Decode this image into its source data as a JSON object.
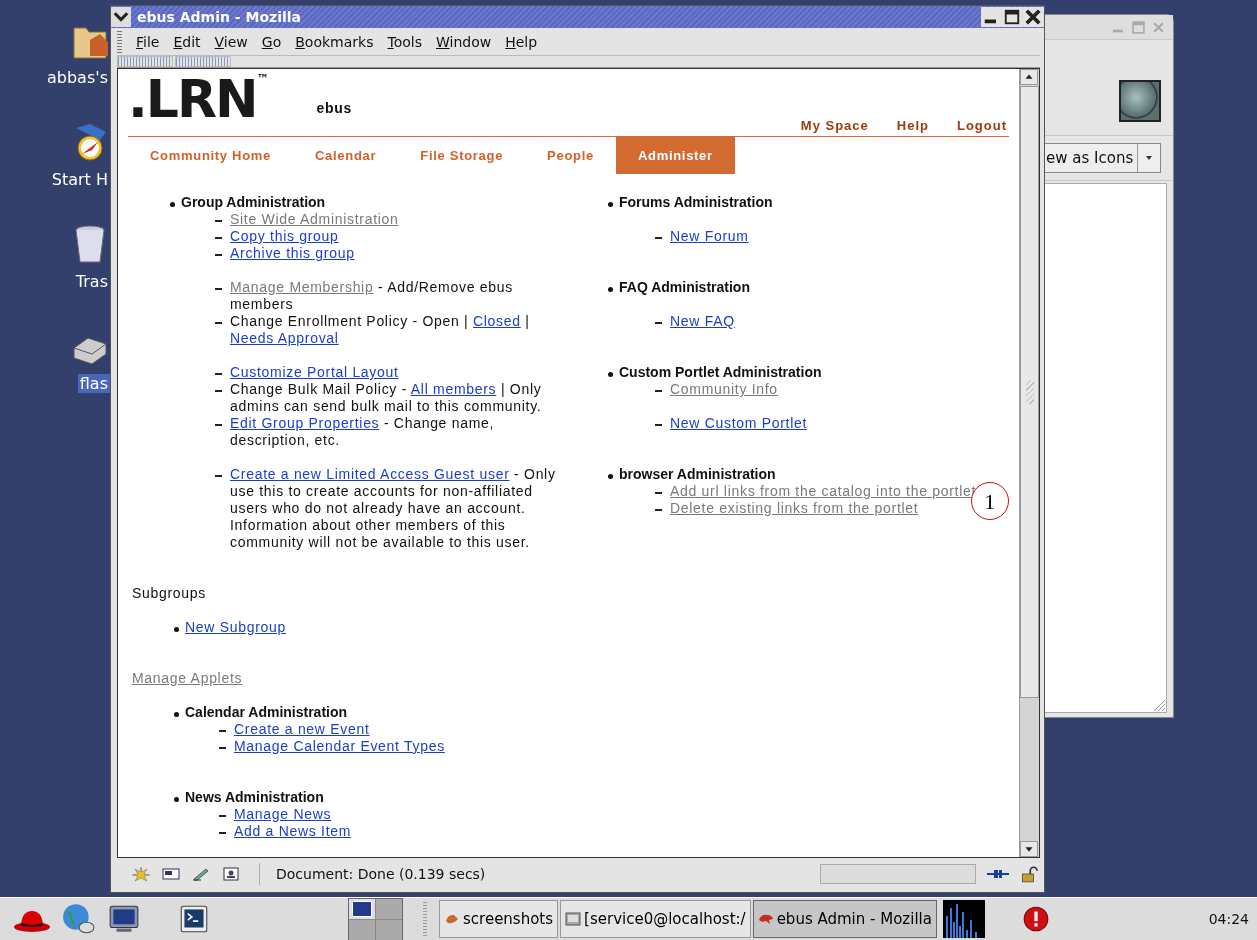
{
  "desktop_icons": [
    {
      "label": "abbas's",
      "kind": "folder",
      "selected": false
    },
    {
      "label": "Start H",
      "kind": "compass",
      "selected": false
    },
    {
      "label": "Tras",
      "kind": "trash",
      "selected": false
    },
    {
      "label": "flas",
      "kind": "drive",
      "selected": true
    }
  ],
  "back_window": {
    "view_mode": "ew as Icons"
  },
  "window": {
    "title": "ebus Admin - Mozilla",
    "menu": [
      "File",
      "Edit",
      "View",
      "Go",
      "Bookmarks",
      "Tools",
      "Window",
      "Help"
    ]
  },
  "page": {
    "logo": ".LRN",
    "trademark": "™",
    "community": "ebus",
    "top_links": [
      "My Space",
      "Help",
      "Logout"
    ],
    "tabs": [
      {
        "label": "Community Home",
        "selected": false
      },
      {
        "label": "Calendar",
        "selected": false
      },
      {
        "label": "File Storage",
        "selected": false
      },
      {
        "label": "People",
        "selected": false
      },
      {
        "label": "Administer",
        "selected": true
      }
    ],
    "left_sections": [
      {
        "title": "Group Administration",
        "kind": "tight",
        "groups": [
          [
            {
              "parts": [
                {
                  "kind": "link",
                  "text": "Site Wide Administration",
                  "visited": true
                }
              ]
            },
            {
              "parts": [
                {
                  "kind": "link",
                  "text": "Copy this group",
                  "visited": false
                }
              ]
            },
            {
              "parts": [
                {
                  "kind": "link",
                  "text": "Archive this group",
                  "visited": false
                }
              ]
            }
          ],
          [
            {
              "parts": [
                {
                  "kind": "link",
                  "text": "Manage Membership",
                  "visited": true
                },
                {
                  "kind": "text",
                  "text": " - Add/Remove ebus members"
                }
              ]
            },
            {
              "parts": [
                {
                  "kind": "text",
                  "text": "Change Enrollment Policy - Open | "
                },
                {
                  "kind": "link",
                  "text": "Closed",
                  "visited": false
                },
                {
                  "kind": "text",
                  "text": " | "
                },
                {
                  "kind": "link",
                  "text": "Needs Approval",
                  "visited": false
                }
              ]
            }
          ],
          [
            {
              "parts": [
                {
                  "kind": "link",
                  "text": "Customize Portal Layout",
                  "visited": false
                }
              ]
            },
            {
              "parts": [
                {
                  "kind": "text",
                  "text": "Change Bulk Mail Policy - "
                },
                {
                  "kind": "link",
                  "text": "All members",
                  "visited": false
                },
                {
                  "kind": "text",
                  "text": " | Only admins can send bulk mail to this community."
                }
              ]
            },
            {
              "parts": [
                {
                  "kind": "link",
                  "text": "Edit Group Properties",
                  "visited": false
                },
                {
                  "kind": "text",
                  "text": " - Change name, description, etc."
                }
              ]
            }
          ],
          [
            {
              "parts": [
                {
                  "kind": "link",
                  "text": "Create a new Limited Access Guest user",
                  "visited": false
                },
                {
                  "kind": "text",
                  "text": " - Only use this to create accounts for non-affiliated users who do not already have an account. Information about other members of this community will not be available to this user."
                }
              ]
            }
          ]
        ]
      }
    ],
    "right_sections": [
      {
        "title": "Forums Administration",
        "kind": "loose",
        "groups": [
          [
            {
              "parts": [
                {
                  "kind": "link",
                  "text": "New Forum",
                  "visited": false
                }
              ]
            }
          ]
        ]
      },
      {
        "title": "FAQ Administration",
        "kind": "loose",
        "groups": [
          [
            {
              "parts": [
                {
                  "kind": "link",
                  "text": "New FAQ",
                  "visited": false
                }
              ]
            }
          ]
        ]
      },
      {
        "title": "Custom Portlet Administration",
        "kind": "tight",
        "groups": [
          [
            {
              "parts": [
                {
                  "kind": "link",
                  "text": "Community Info",
                  "visited": true
                }
              ]
            }
          ],
          [
            {
              "parts": [
                {
                  "kind": "link",
                  "text": "New Custom Portlet",
                  "visited": false
                }
              ]
            }
          ]
        ]
      },
      {
        "title": "browser Administration",
        "kind": "tight",
        "groups": [
          [
            {
              "parts": [
                {
                  "kind": "link",
                  "text": "Add url links from the catalog into the portlet",
                  "visited": true
                }
              ]
            },
            {
              "parts": [
                {
                  "kind": "link",
                  "text": "Delete existing links from the portlet",
                  "visited": true
                }
              ]
            }
          ]
        ]
      }
    ],
    "subgroups": {
      "heading": "Subgroups",
      "links": [
        {
          "text": "New Subgroup",
          "visited": false
        }
      ]
    },
    "applets_link": {
      "text": "Manage Applets",
      "visited": true
    },
    "applet_sections": [
      {
        "title": "Calendar Administration",
        "kind": "tight",
        "groups": [
          [
            {
              "parts": [
                {
                  "kind": "link",
                  "text": "Create a new Event",
                  "visited": false
                }
              ]
            },
            {
              "parts": [
                {
                  "kind": "link",
                  "text": "Manage Calendar Event Types",
                  "visited": false
                }
              ]
            }
          ]
        ]
      },
      {
        "title": "News Administration",
        "kind": "tight",
        "groups": [
          [
            {
              "parts": [
                {
                  "kind": "link",
                  "text": "Manage News",
                  "visited": false
                }
              ]
            },
            {
              "parts": [
                {
                  "kind": "link",
                  "text": "Add a News Item",
                  "visited": false
                }
              ]
            }
          ]
        ]
      }
    ]
  },
  "callout": "1",
  "status_bar": {
    "text": "Document: Done (0.139 secs)",
    "level": 0
  },
  "taskbar": {
    "tasks": [
      {
        "label": "screenshots",
        "kind": "folder",
        "selected": false
      },
      {
        "label": "[service0@localhost:/",
        "kind": "terminal",
        "selected": false
      },
      {
        "label": "ebus Admin - Mozilla",
        "kind": "browser",
        "selected": true
      }
    ],
    "clock": "04:24"
  }
}
